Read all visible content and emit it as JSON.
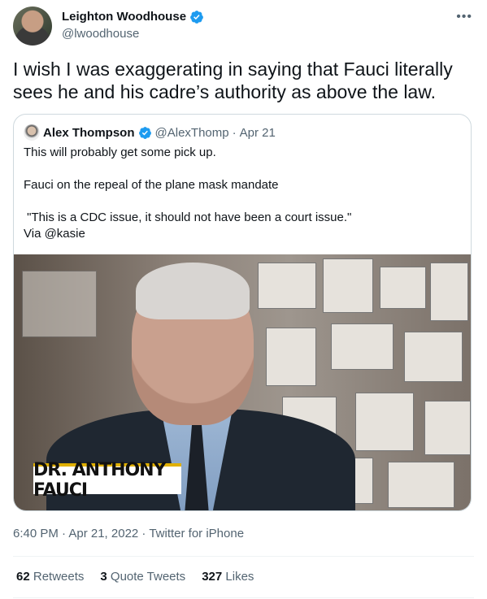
{
  "author": {
    "name": "Leighton Woodhouse",
    "handle": "@lwoodhouse"
  },
  "more_icon": "more-horizontal-icon",
  "tweet_text": "I wish I was exaggerating in saying that Fauci literally sees he and his cadre’s authority as above the law.",
  "quote": {
    "name": "Alex Thompson",
    "handle": "@AlexThomp",
    "separator": "·",
    "date": "Apr 21",
    "lines": [
      "This will probably get some pick up.",
      "Fauci on the repeal of the plane mask mandate",
      " \"This is a CDC issue, it should not have been a court issue.\"",
      "Via @kasie"
    ],
    "media_caption": "DR. ANTHONY FAUCI"
  },
  "meta": {
    "time": "6:40 PM · Apr 21, 2022 · Twitter for iPhone"
  },
  "stats": [
    {
      "count": "62",
      "label": "Retweets"
    },
    {
      "count": "3",
      "label": "Quote Tweets"
    },
    {
      "count": "327",
      "label": "Likes"
    }
  ],
  "colors": {
    "verified": "#1d9bf0",
    "secondary_text": "#536471",
    "caption_accent": "#e0b000"
  }
}
